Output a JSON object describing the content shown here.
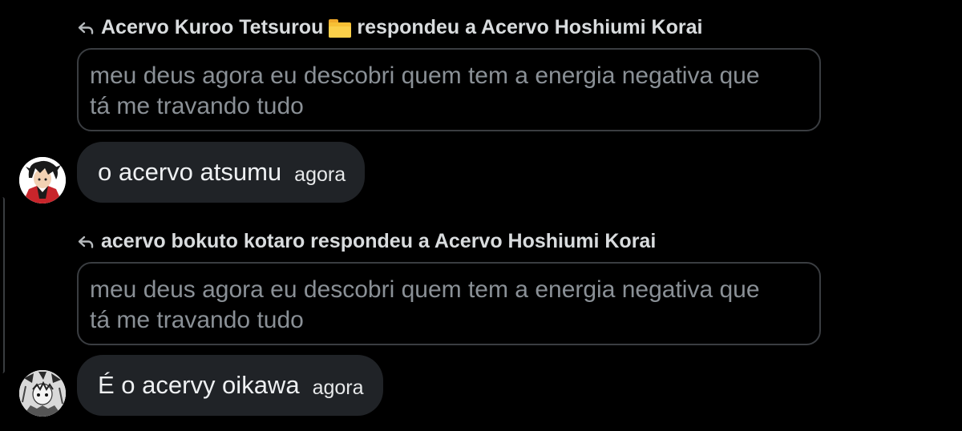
{
  "messages": [
    {
      "reply_header": {
        "prefix": "Acervo Kuroo Tetsurou",
        "suffix": "respondeu a Acervo Hoshiumi Korai",
        "icon": "folder-emoji"
      },
      "quoted_text_line1": "meu deus agora eu descobri quem tem a energia negativa que",
      "quoted_text_line2": "tá me travando tudo",
      "text": "o acervo atsumu",
      "time": "agora",
      "avatar": "kuroo-avatar"
    },
    {
      "reply_header": {
        "prefix": "acervo bokuto kotaro respondeu a Acervo Hoshiumi Korai"
      },
      "quoted_text_line1": "meu deus agora eu descobri quem tem a energia negativa que",
      "quoted_text_line2": "tá me travando tudo",
      "text": "É o acervy oikawa",
      "time": "agora",
      "avatar": "bokuto-avatar"
    }
  ],
  "colors": {
    "background": "#000000",
    "bubble": "#202327",
    "quote_border": "#3a3d41",
    "quote_text": "#8a9096",
    "folder": "#f7c035"
  }
}
